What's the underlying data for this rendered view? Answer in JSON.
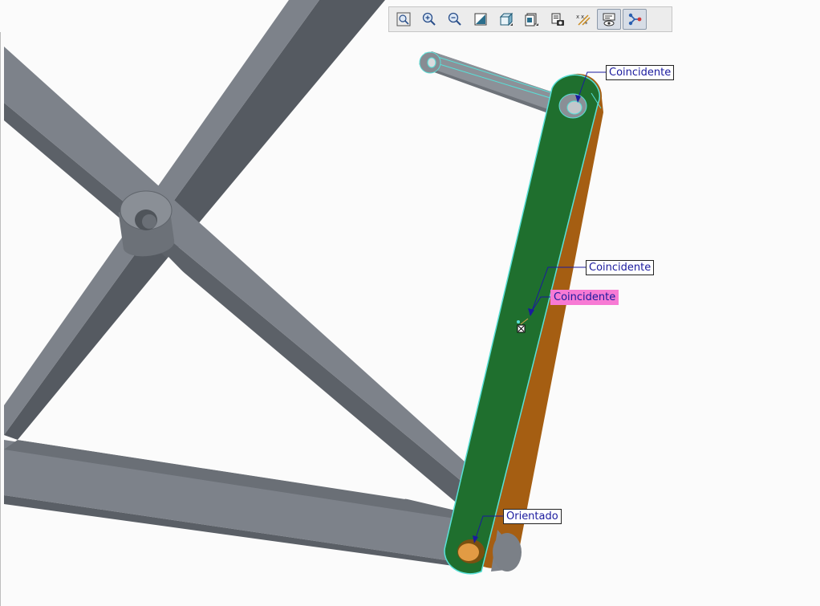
{
  "toolbar": {
    "items": [
      {
        "icon": "zoom-fit-icon"
      },
      {
        "icon": "zoom-in-icon"
      },
      {
        "icon": "zoom-out-icon"
      },
      {
        "icon": "repaint-icon"
      },
      {
        "icon": "display-style-icon"
      },
      {
        "icon": "saved-views-icon"
      },
      {
        "icon": "view-manager-icon"
      },
      {
        "icon": "datum-display-icon"
      },
      {
        "icon": "annotation-display-icon",
        "active": true
      },
      {
        "icon": "constraint-display-icon",
        "active": true
      }
    ]
  },
  "constraints": {
    "top": "Coincidente",
    "middle": "Coincidente",
    "highlighted": "Coincidente",
    "bottom": "Orientado"
  },
  "colors": {
    "frame": "#7d828a",
    "selected_part": "#1f6f2e",
    "part_edge": "#a55e12",
    "highlight_edge": "#58e0d8",
    "callout_text": "#1a1a9e",
    "highlight_callout": "#f77ad4"
  }
}
